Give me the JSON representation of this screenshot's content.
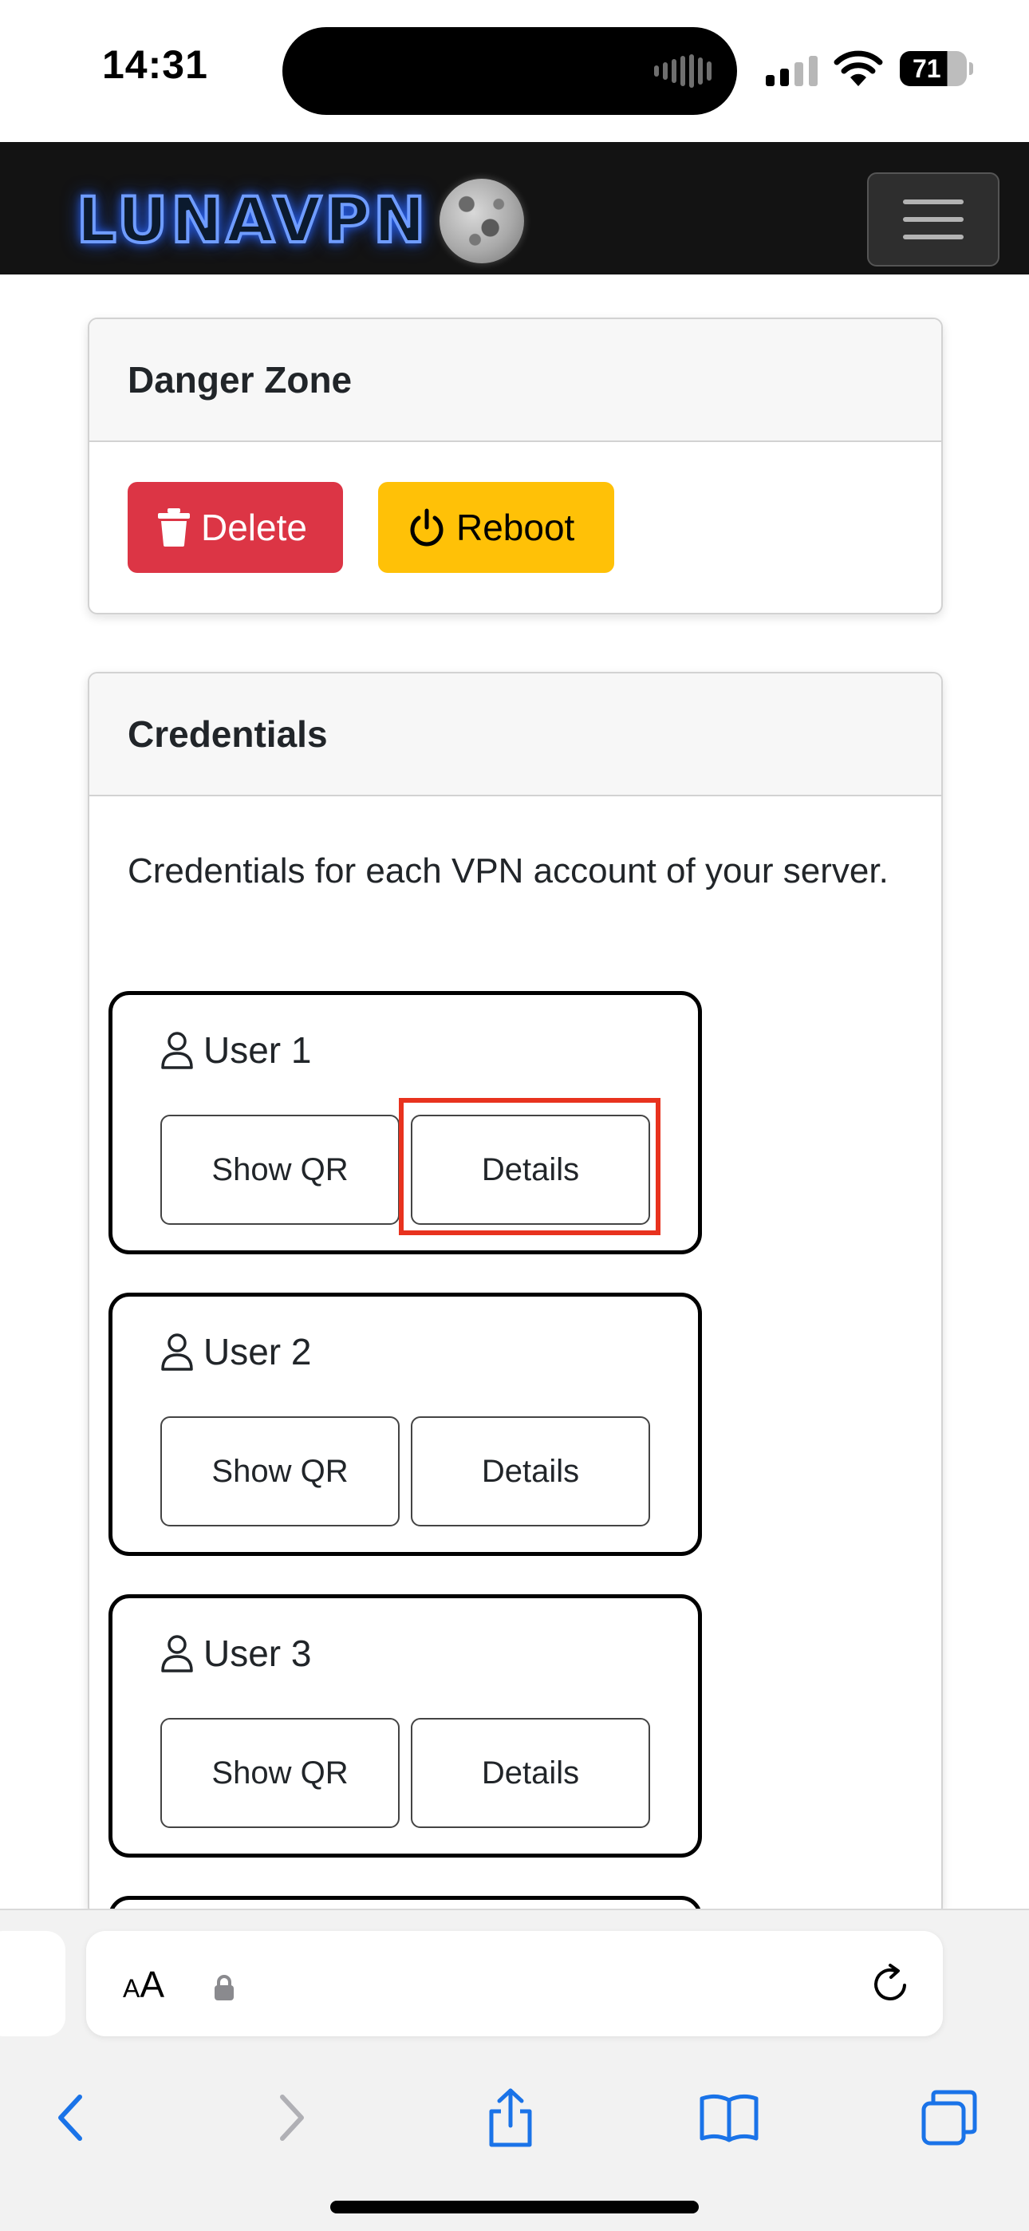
{
  "status_bar": {
    "time": "14:31",
    "battery_level": "71",
    "cellular_bars": 2,
    "icons": [
      "signal-icon",
      "wifi-icon",
      "battery-icon"
    ]
  },
  "navbar": {
    "brand": "LUNAVPN",
    "brand_color": "#6f9cff",
    "logo_icon": "moon-icon",
    "menu_icon": "hamburger-menu-icon"
  },
  "danger_zone": {
    "title": "Danger Zone",
    "delete_label": "Delete",
    "delete_icon": "trash-icon",
    "delete_color": "#dc3545",
    "reboot_label": "Reboot",
    "reboot_icon": "power-icon",
    "reboot_color": "#ffc107"
  },
  "credentials": {
    "title": "Credentials",
    "description": "Credentials for each VPN account of your server.",
    "users": [
      {
        "name": "User 1",
        "qr_label": "Show QR",
        "details_label": "Details"
      },
      {
        "name": "User 2",
        "qr_label": "Show QR",
        "details_label": "Details"
      },
      {
        "name": "User 3",
        "qr_label": "Show QR",
        "details_label": "Details"
      }
    ],
    "highlight_color": "#e8321e"
  },
  "safari": {
    "text_size_label": "AA",
    "icons": [
      "lock-icon",
      "reload-icon",
      "back-icon",
      "forward-icon",
      "share-icon",
      "bookmarks-icon",
      "tabs-icon"
    ]
  }
}
